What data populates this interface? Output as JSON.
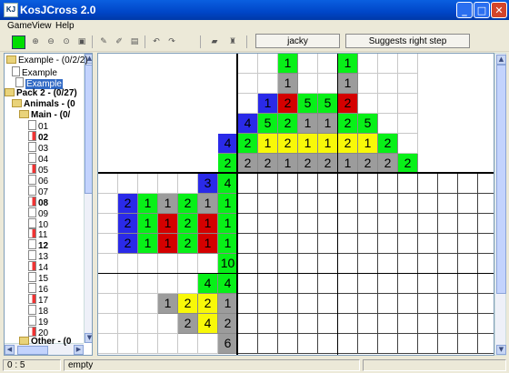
{
  "window": {
    "title": "KosJCross 2.0",
    "icon": "app-icon"
  },
  "menu": [
    "Game",
    "View",
    "Help"
  ],
  "toolbar": {
    "player_name": "jacky",
    "suggest_label": "Suggests right step",
    "buttons": [
      "color-swatch",
      "zoom-in-icon",
      "zoom-out-icon",
      "zoom-fit-icon",
      "zoom-actual-icon",
      "pencil-icon",
      "eraser-icon",
      "clipboard-icon",
      "undo-icon",
      "redo-icon",
      "open-folder-icon",
      "stamp-icon"
    ]
  },
  "tree": {
    "items": [
      {
        "label": "Example - (0/2/2)",
        "icon": "folder-icon"
      },
      {
        "label": "Example",
        "icon": "doc-icon"
      },
      {
        "label": "Example",
        "icon": "doc-icon",
        "selected": true
      },
      {
        "label": "Pack 2 - (0/27)",
        "icon": "folder-icon",
        "bold": true
      },
      {
        "label": "Animals - (0",
        "icon": "folder-icon",
        "bold": true
      },
      {
        "label": "Main - (0/",
        "icon": "folder-icon",
        "bold": true
      },
      {
        "label": "01"
      },
      {
        "label": "02",
        "bold": true
      },
      {
        "label": "03"
      },
      {
        "label": "04"
      },
      {
        "label": "05"
      },
      {
        "label": "06"
      },
      {
        "label": "07"
      },
      {
        "label": "08",
        "bold": true
      },
      {
        "label": "09"
      },
      {
        "label": "10"
      },
      {
        "label": "11"
      },
      {
        "label": "12",
        "bold": true
      },
      {
        "label": "13"
      },
      {
        "label": "14"
      },
      {
        "label": "15"
      },
      {
        "label": "16"
      },
      {
        "label": "17"
      },
      {
        "label": "18"
      },
      {
        "label": "19"
      },
      {
        "label": "20"
      },
      {
        "label": "Other - (0",
        "icon": "folder-icon",
        "bold": true
      }
    ]
  },
  "board": {
    "top_clues": [
      [
        {
          "v": "1",
          "c": "g"
        },
        {
          "v": "1",
          "c": "g"
        }
      ],
      [
        {
          "v": "1",
          "c": "gr"
        },
        {
          "v": "1",
          "c": "gr"
        }
      ],
      [
        {
          "v": "1",
          "c": "b"
        },
        {
          "v": "2",
          "c": "r"
        },
        {
          "v": "5",
          "c": "g"
        },
        {
          "v": "5",
          "c": "g"
        },
        {
          "v": "2",
          "c": "r"
        }
      ],
      [
        {
          "v": "4",
          "c": "b"
        },
        {
          "v": "5",
          "c": "g"
        },
        {
          "v": "2",
          "c": "g"
        },
        {
          "v": "1",
          "c": "gr"
        },
        {
          "v": "1",
          "c": "gr"
        },
        {
          "v": "2",
          "c": "g"
        },
        {
          "v": "5",
          "c": "g"
        }
      ],
      [
        {
          "v": "4",
          "c": "b"
        },
        {
          "v": "2",
          "c": "g"
        },
        {
          "v": "1",
          "c": "y"
        },
        {
          "v": "2",
          "c": "y"
        },
        {
          "v": "1",
          "c": "y"
        },
        {
          "v": "1",
          "c": "y"
        },
        {
          "v": "2",
          "c": "y"
        },
        {
          "v": "1",
          "c": "y"
        },
        {
          "v": "2",
          "c": "g"
        }
      ],
      [
        {
          "v": "2",
          "c": "g"
        },
        {
          "v": "2",
          "c": "gr"
        },
        {
          "v": "2",
          "c": "gr"
        },
        {
          "v": "1",
          "c": "gr"
        },
        {
          "v": "2",
          "c": "gr"
        },
        {
          "v": "2",
          "c": "gr"
        },
        {
          "v": "1",
          "c": "gr"
        },
        {
          "v": "2",
          "c": "gr"
        },
        {
          "v": "2",
          "c": "gr"
        },
        {
          "v": "2",
          "c": "g"
        }
      ]
    ],
    "left_clues": [
      [
        {
          "v": "3",
          "c": "b"
        },
        {
          "v": "4",
          "c": "g"
        }
      ],
      [
        {
          "v": "2",
          "c": "b"
        },
        {
          "v": "1",
          "c": "g"
        },
        {
          "v": "1",
          "c": "gr"
        },
        {
          "v": "2",
          "c": "g"
        },
        {
          "v": "1",
          "c": "gr"
        },
        {
          "v": "1",
          "c": "g"
        }
      ],
      [
        {
          "v": "2",
          "c": "b"
        },
        {
          "v": "1",
          "c": "g"
        },
        {
          "v": "1",
          "c": "r"
        },
        {
          "v": "2",
          "c": "g"
        },
        {
          "v": "1",
          "c": "r"
        },
        {
          "v": "1",
          "c": "g"
        }
      ],
      [
        {
          "v": "2",
          "c": "b"
        },
        {
          "v": "1",
          "c": "g"
        },
        {
          "v": "1",
          "c": "r"
        },
        {
          "v": "2",
          "c": "g"
        },
        {
          "v": "1",
          "c": "r"
        },
        {
          "v": "1",
          "c": "g"
        }
      ],
      [
        {
          "v": "10",
          "c": "g"
        }
      ],
      [
        {
          "v": "4",
          "c": "g"
        },
        {
          "v": "4",
          "c": "g"
        }
      ],
      [
        {
          "v": "1",
          "c": "gr"
        },
        {
          "v": "2",
          "c": "y"
        },
        {
          "v": "2",
          "c": "y"
        },
        {
          "v": "1",
          "c": "gr"
        }
      ],
      [
        {
          "v": "2",
          "c": "gr"
        },
        {
          "v": "4",
          "c": "y"
        },
        {
          "v": "2",
          "c": "gr"
        }
      ],
      [
        {
          "v": "6",
          "c": "gr"
        }
      ]
    ]
  },
  "status": {
    "position": "0 : 5",
    "state": "empty"
  }
}
